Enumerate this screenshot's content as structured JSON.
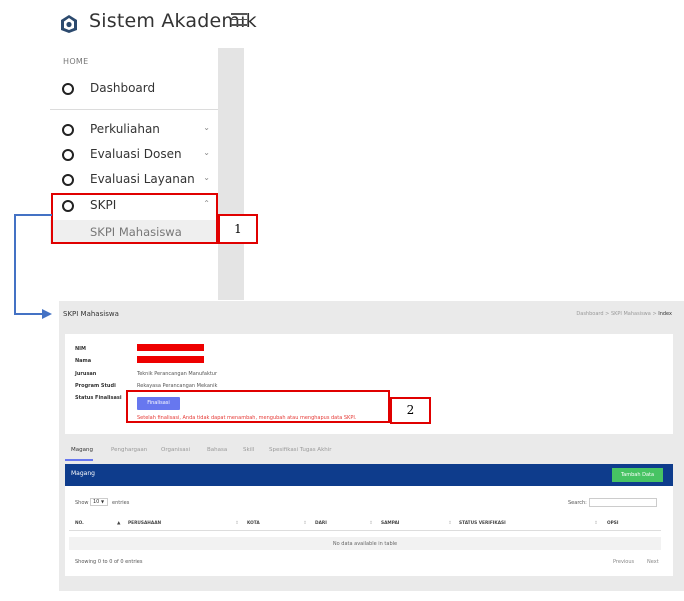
{
  "app": {
    "title": "Sistem Akademik"
  },
  "sidebar": {
    "section_home": "HOME",
    "dashboard": "Dashboard",
    "items": [
      {
        "label": "Perkuliahan",
        "expanded": false
      },
      {
        "label": "Evaluasi Dosen",
        "expanded": false
      },
      {
        "label": "Evaluasi Layanan",
        "expanded": false
      },
      {
        "label": "SKPI",
        "expanded": true
      }
    ],
    "submenu": {
      "label": "SKPI Mahasiswa"
    }
  },
  "callouts": {
    "one": "1",
    "two": "2"
  },
  "page": {
    "title": "SKPI Mahasiswa",
    "breadcrumb": [
      "Dashboard",
      ">",
      "SKPI Mahasiswa",
      ">",
      "Index"
    ]
  },
  "student": {
    "nim_label": "NIM",
    "nama_label": "Nama",
    "jurusan_label": "Jurusan",
    "jurusan_value": "Teknik Perancangan Manufaktur",
    "prodi_label": "Program Studi",
    "prodi_value": "Rekayasa Perancangan Mekanik",
    "status_label": "Status Finalisasi",
    "finalize_button": "Finalisasi",
    "warning": "Setelah finalisasi, Anda tidak dapat menambah, mengubah atau menghapus data SKPI."
  },
  "tabs": [
    "Magang",
    "Penghargaan",
    "Organisasi",
    "Bahasa",
    "Skill",
    "Spesifikasi Tugas Akhir"
  ],
  "panel": {
    "title": "Magang",
    "add_button": "Tambah Data"
  },
  "table": {
    "show_prefix": "Show",
    "show_value": "10",
    "show_suffix": "entries",
    "search_label": "Search:",
    "columns": [
      "NO.",
      "PERUSAHAAN",
      "KOTA",
      "DARI",
      "SAMPAI",
      "STATUS VERIFIKASI",
      "OPSI"
    ],
    "empty_message": "No data available in table",
    "info": "Showing 0 to 0 of 0 entries",
    "prev": "Previous",
    "next": "Next"
  },
  "colors": {
    "highlight": "#e00000",
    "arrow": "#4472c4",
    "primary": "#6777ef",
    "panel_header": "#0e3c8c",
    "success": "#47c363"
  }
}
